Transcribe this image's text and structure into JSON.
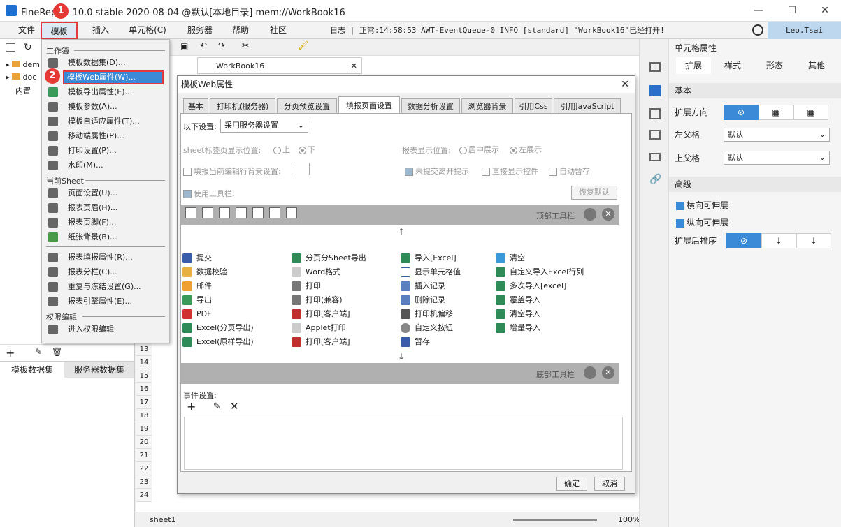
{
  "app": {
    "title": "FineReport 10.0 stable 2020-08-04 @默认[本地目录]    mem://WorkBook16",
    "user": "Leo.Tsai",
    "log": "日志 | 正常:14:58:53 AWT-EventQueue-0 INFO [standard] \"WorkBook16\"已经打开!"
  },
  "menubar": [
    "文件",
    "模板",
    "插入",
    "单元格(C)",
    "服务器",
    "帮助",
    "社区"
  ],
  "dropdown": {
    "sec_workbook": "工作簿",
    "items_workbook": [
      "模板数据集(D)...",
      "模板Web属性(W)...",
      "模板导出属性(E)...",
      "模板参数(A)...",
      "模板自适应属性(T)...",
      "移动端属性(P)...",
      "打印设置(P)...",
      "水印(M)..."
    ],
    "sec_sheet": "当前Sheet",
    "items_sheet": [
      "页面设置(U)...",
      "报表页眉(H)...",
      "报表页脚(F)...",
      "纸张背景(B)...",
      "报表填报属性(R)...",
      "报表分栏(C)...",
      "重复与冻结设置(G)...",
      "报表引擎属性(E)..."
    ],
    "sec_perm": "权限编辑",
    "items_perm": [
      "进入权限编辑"
    ]
  },
  "left": {
    "tree": [
      "dem",
      "doc",
      "内置"
    ],
    "tabs": [
      "模板数据集",
      "服务器数据集"
    ]
  },
  "center": {
    "tab": "WorkBook16",
    "rows": [
      "13",
      "14",
      "15",
      "16",
      "17",
      "18",
      "19",
      "20",
      "21",
      "22",
      "23",
      "24"
    ],
    "sheet": "sheet1",
    "zoom": "100%"
  },
  "dialog": {
    "title": "模板Web属性",
    "tabs": [
      "基本",
      "打印机(服务器)",
      "分页预览设置",
      "填报页面设置",
      "数据分析设置",
      "浏览器背景",
      "引用Css",
      "引用JavaScript"
    ],
    "setting_label": "以下设置:",
    "setting_value": "采用服务器设置",
    "sheet_pos_label": "sheet标签页显示位置:",
    "sheet_pos_up": "上",
    "sheet_pos_down": "下",
    "report_pos_label": "报表显示位置:",
    "report_pos_center": "居中展示",
    "report_pos_left": "左展示",
    "fill_bg": "填报当前编辑行背景设置:",
    "unsubmit": "未提交离开提示",
    "direct_show": "直接显示控件",
    "auto_save": "自动暂存",
    "use_toolbar": "使用工具栏:",
    "restore": "恢复默认",
    "top_toolbar": "顶部工具栏",
    "bottom_toolbar": "底部工具栏",
    "buttons": [
      [
        "提交",
        "分页分Sheet导出",
        "导入[Excel]",
        "清空"
      ],
      [
        "数据校验",
        "Word格式",
        "显示单元格值",
        "自定义导入Excel行列"
      ],
      [
        "邮件",
        "打印",
        "插入记录",
        "多次导入[excel]"
      ],
      [
        "导出",
        "打印(兼容)",
        "删除记录",
        "覆盖导入"
      ],
      [
        "PDF",
        "打印[客户端]",
        "打印机偏移",
        "清空导入"
      ],
      [
        "Excel(分页导出)",
        "Applet打印",
        "自定义按钮",
        "增量导入"
      ],
      [
        "Excel(原样导出)",
        "打印[客户端]",
        "暂存",
        ""
      ]
    ],
    "event_label": "事件设置:",
    "ok": "确定",
    "cancel": "取消"
  },
  "right": {
    "title": "单元格属性",
    "tabs": [
      "扩展",
      "样式",
      "形态",
      "其他"
    ],
    "sec_basic": "基本",
    "expand_dir": "扩展方向",
    "left_parent": "左父格",
    "left_parent_val": "默认",
    "up_parent": "上父格",
    "up_parent_val": "默认",
    "sec_adv": "高级",
    "h_expand": "横向可伸展",
    "v_expand": "纵向可伸展",
    "sort_after": "扩展后排序"
  },
  "badges": [
    "1",
    "2",
    "3"
  ]
}
